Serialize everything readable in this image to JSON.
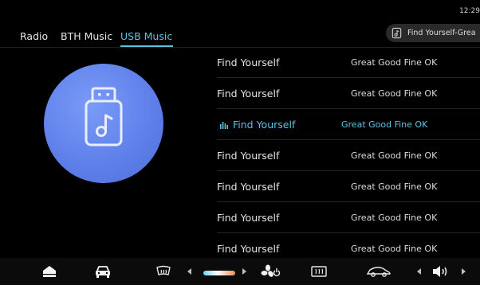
{
  "status": {
    "time": "12:29"
  },
  "tabs": [
    {
      "label": "Radio",
      "active": false
    },
    {
      "label": "BTH Music",
      "active": false
    },
    {
      "label": "USB Music",
      "active": true
    }
  ],
  "now_playing": {
    "text": "Find Yourself-Grea",
    "icon": "music-note-icon"
  },
  "source_art": {
    "icon": "usb-music-icon"
  },
  "tracks": [
    {
      "title": "Find Yourself",
      "artist": "Great Good Fine OK",
      "playing": false
    },
    {
      "title": "Find Yourself",
      "artist": "Great Good Fine OK",
      "playing": false
    },
    {
      "title": "Find Yourself",
      "artist": "Great Good Fine OK",
      "playing": true
    },
    {
      "title": "Find Yourself",
      "artist": "Great Good Fine OK",
      "playing": false
    },
    {
      "title": "Find Yourself",
      "artist": "Great Good Fine OK",
      "playing": false
    },
    {
      "title": "Find Yourself",
      "artist": "Great Good Fine OK",
      "playing": false
    },
    {
      "title": "Find Yourself",
      "artist": "Great Good Fine OK",
      "playing": false
    }
  ],
  "bottom_bar": [
    "home-icon",
    "car-icon",
    "rear-defrost-icon",
    "left-arrow-icon",
    "temperature-slider",
    "right-arrow-icon",
    "fan-icon",
    "front-defrost-icon",
    "car-side-icon",
    "left-arrow-icon",
    "volume-icon",
    "right-arrow-icon"
  ],
  "colors": {
    "accent": "#5cc3e0",
    "usb_circle": "#5d7ee9",
    "background": "#000000"
  }
}
